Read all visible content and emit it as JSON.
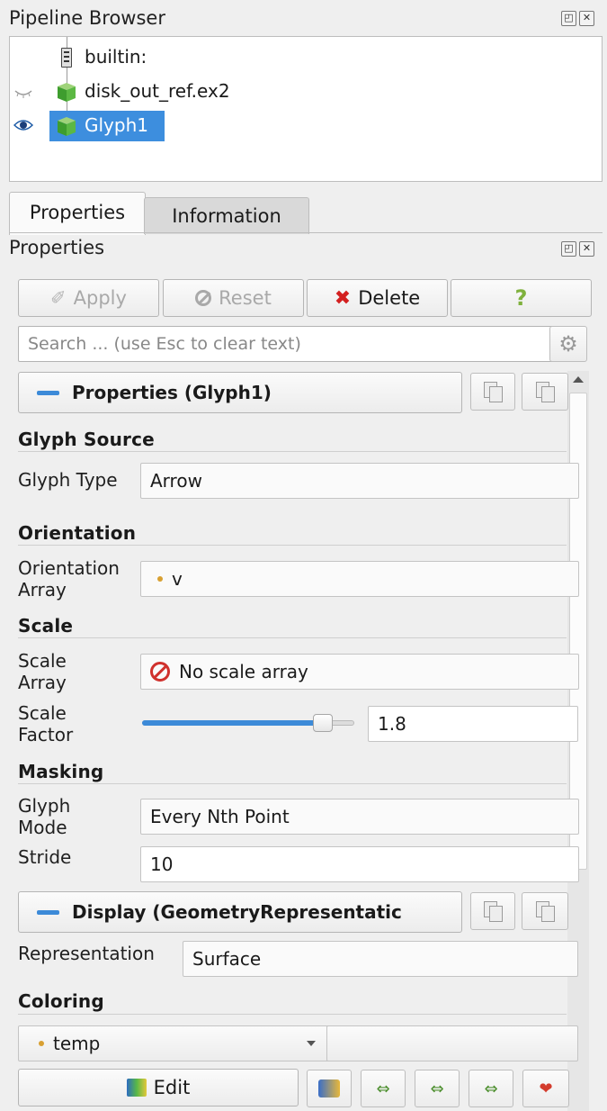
{
  "pipeline_browser": {
    "title": "Pipeline Browser",
    "items": [
      {
        "label": "builtin:",
        "icon": "server-icon"
      },
      {
        "label": "disk_out_ref.ex2",
        "icon": "dataset-cube-icon",
        "visibility": "hidden"
      },
      {
        "label": "Glyph1",
        "icon": "dataset-cube-icon",
        "visibility": "visible",
        "selected": true
      }
    ]
  },
  "tabs": [
    {
      "label": "Properties",
      "active": true
    },
    {
      "label": "Information",
      "active": false
    }
  ],
  "properties_panel": {
    "title": "Properties",
    "buttons": {
      "apply": "Apply",
      "reset": "Reset",
      "delete": "Delete",
      "help": "?"
    },
    "search_placeholder": "Search ... (use Esc to clear text)",
    "properties_header": "Properties (Glyph1)",
    "sections": {
      "glyph_source": "Glyph Source",
      "orientation": "Orientation",
      "scale": "Scale",
      "masking": "Masking",
      "coloring": "Coloring"
    },
    "fields": {
      "glyph_type_label": "Glyph Type",
      "glyph_type_value": "Arrow",
      "orientation_array_label_1": "Orientation",
      "orientation_array_label_2": "Array",
      "orientation_array_value": "v",
      "scale_array_label_1": "Scale",
      "scale_array_label_2": "Array",
      "scale_array_value": "No scale array",
      "scale_factor_label_1": "Scale",
      "scale_factor_label_2": "Factor",
      "scale_factor_value": "1.8",
      "scale_factor_slider_fraction": 0.85,
      "glyph_mode_label_1": "Glyph",
      "glyph_mode_label_2": "Mode",
      "glyph_mode_value": "Every Nth Point",
      "stride_label": "Stride",
      "stride_value": "10"
    },
    "display_header": "Display (GeometryRepresentatic",
    "representation_label": "Representation",
    "representation_value": "Surface",
    "coloring_value": "temp",
    "edit_label": "Edit"
  },
  "colors": {
    "selection": "#3d8ede",
    "accent_blue": "#3c8ad8",
    "delete_red": "#d32020",
    "array_dot": "#d8a032"
  }
}
